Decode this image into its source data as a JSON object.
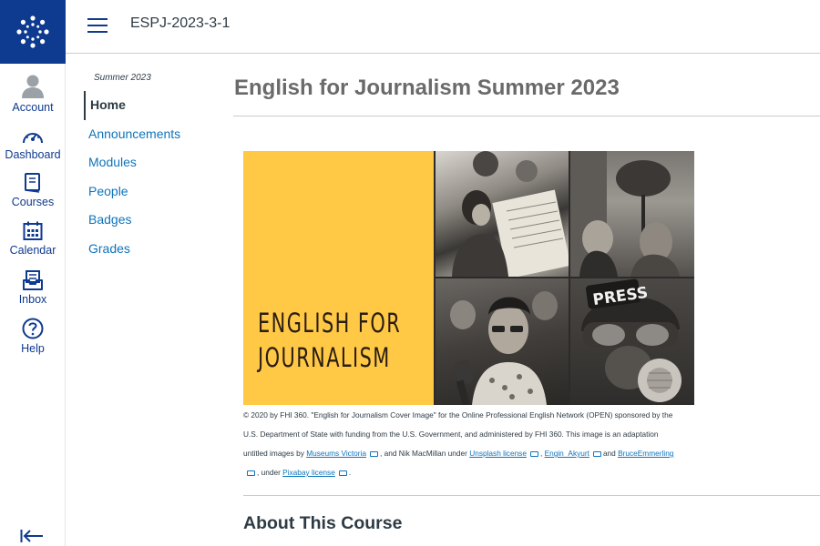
{
  "global_nav": {
    "items": [
      {
        "label": "Account",
        "icon": "account-icon"
      },
      {
        "label": "Dashboard",
        "icon": "dashboard-icon"
      },
      {
        "label": "Courses",
        "icon": "courses-icon"
      },
      {
        "label": "Calendar",
        "icon": "calendar-icon"
      },
      {
        "label": "Inbox",
        "icon": "inbox-icon"
      },
      {
        "label": "Help",
        "icon": "help-icon"
      }
    ]
  },
  "header": {
    "breadcrumb": "ESPJ-2023-3-1"
  },
  "course_nav": {
    "term": "Summer 2023",
    "links": [
      {
        "label": "Home",
        "active": true
      },
      {
        "label": "Announcements"
      },
      {
        "label": "Modules"
      },
      {
        "label": "People"
      },
      {
        "label": "Badges"
      },
      {
        "label": "Grades"
      }
    ]
  },
  "page": {
    "title": "English for Journalism Summer 2023",
    "cover_title_line1": "ENGLISH FOR",
    "cover_title_line2": "JOURNALISM",
    "cover_badge": "PRESS",
    "caption": {
      "line1": "© 2020 by FHI 360. \"English for Journalism Cover Image\" for the Online Professional English Network (OPEN) sponsored by the",
      "line2": "U.S. Department of State with funding from the U.S. Government, and administered by FHI 360. This image is an adaptation",
      "line3_start": "untitled images by",
      "link_museums": "Museums Victoria",
      "line3_mid": ", and  Nik MacMillan under",
      "link_unsplash": "Unsplash license",
      "link_engin": "Engin_Akyurt",
      "line3_and": "and",
      "link_bruce": "BruceEmmerling",
      "line4_under": ", under",
      "link_pixabay": "Pixabay license"
    },
    "section_heading": "About This Course"
  },
  "colors": {
    "brand": "#0e3a8f",
    "link": "#0e74bb",
    "cover_yellow": "#ffc845"
  }
}
